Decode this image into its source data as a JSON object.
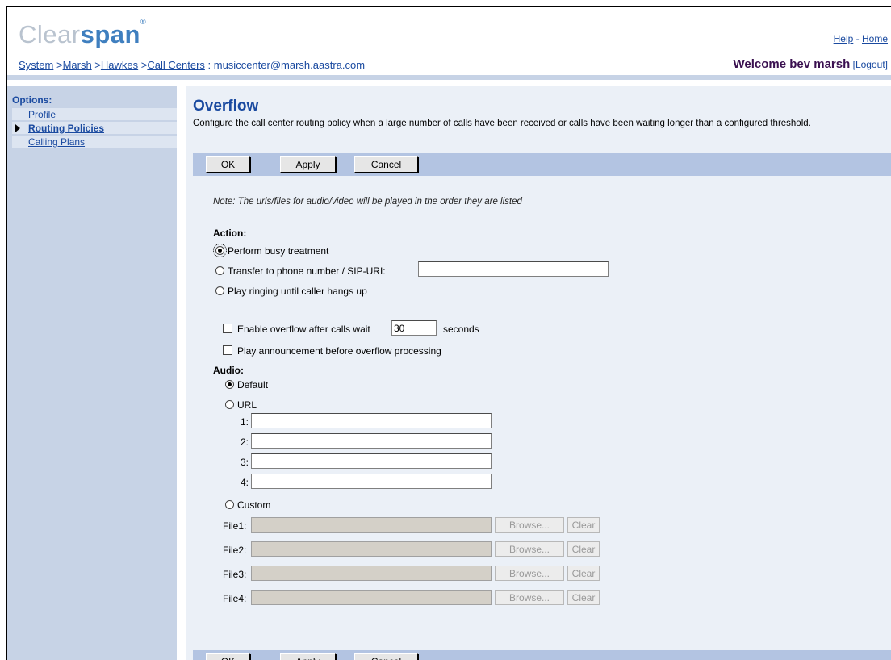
{
  "header": {
    "logo_part1": "Clear",
    "logo_part2": "span",
    "logo_reg": "®",
    "help": "Help",
    "separator": " - ",
    "home": "Home",
    "welcome": "Welcome bev marsh",
    "logout": "[Logout]"
  },
  "breadcrumb": {
    "items": [
      "System",
      "Marsh",
      "Hawkes",
      "Call Centers"
    ],
    "sep": " >",
    "current": " : musiccenter@marsh.aastra.com"
  },
  "sidebar": {
    "title": "Options:",
    "items": [
      {
        "label": "Profile",
        "active": false
      },
      {
        "label": "Routing Policies",
        "active": true
      },
      {
        "label": "Calling Plans",
        "active": false
      }
    ]
  },
  "page": {
    "title": "Overflow",
    "description": "Configure the call center routing policy when a large number of calls have been received or calls have been waiting longer than a configured threshold."
  },
  "buttons": {
    "ok": "OK",
    "apply": "Apply",
    "cancel": "Cancel"
  },
  "form": {
    "note": "Note: The urls/files for audio/video will be played in the order they are listed",
    "action_label": "Action:",
    "action_options": [
      "Perform busy treatment",
      "Transfer to phone number / SIP-URI:",
      "Play ringing until caller hangs up"
    ],
    "selected_action": 0,
    "transfer_value": "",
    "enable_overflow_label": "Enable overflow after calls wait",
    "enable_overflow_checked": false,
    "wait_seconds": "30",
    "seconds_label": "seconds",
    "play_announcement_label": "Play announcement before overflow processing",
    "play_announcement_checked": false,
    "audio_label": "Audio:",
    "audio_default": "Default",
    "audio_url": "URL",
    "audio_custom": "Custom",
    "selected_audio": "Default",
    "url_labels": [
      "1:",
      "2:",
      "3:",
      "4:"
    ],
    "url_values": [
      "",
      "",
      "",
      ""
    ],
    "file_labels": [
      "File1:",
      "File2:",
      "File3:",
      "File4:"
    ],
    "browse": "Browse...",
    "clear": "Clear"
  }
}
